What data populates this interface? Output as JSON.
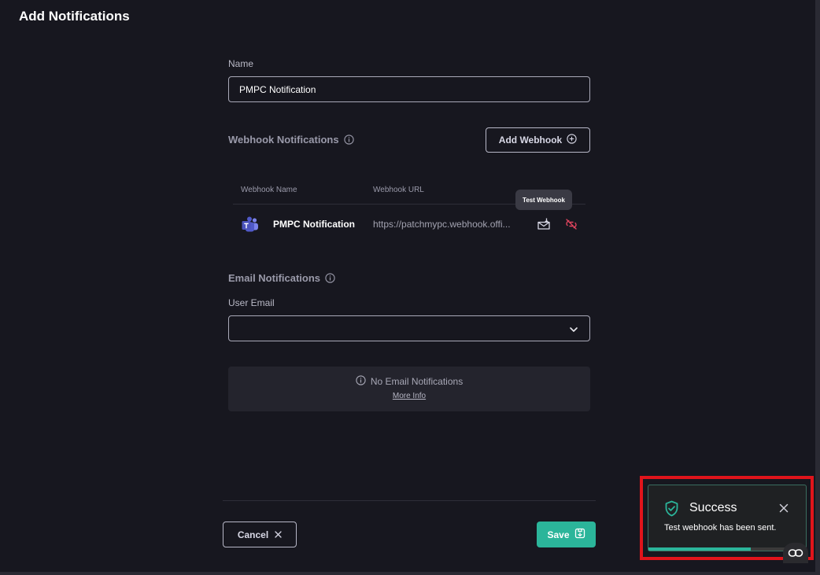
{
  "page": {
    "title": "Add Notifications"
  },
  "name_field": {
    "label": "Name",
    "value": "PMPC Notification"
  },
  "webhook": {
    "section_title": "Webhook Notifications",
    "add_button_label": "Add Webhook",
    "columns": [
      "Webhook Name",
      "Webhook URL"
    ],
    "rows": [
      {
        "name": "PMPC Notification",
        "url": "https://patchmypc.webhook.offi...",
        "icon": "microsoft-teams-icon"
      }
    ],
    "tooltip": "Test Webhook"
  },
  "email": {
    "section_title": "Email Notifications",
    "user_email_label": "User Email",
    "selected_value": "",
    "empty_message": "No Email Notifications",
    "more_info_label": "More Info"
  },
  "footer": {
    "cancel_label": "Cancel",
    "save_label": "Save"
  },
  "toast": {
    "title": "Success",
    "message": "Test webhook has been sent.",
    "progress": 0.65
  },
  "colors": {
    "background": "#17171f",
    "accent": "#2bb59a",
    "danger": "#e0445e",
    "highlight": "#e0141b"
  }
}
